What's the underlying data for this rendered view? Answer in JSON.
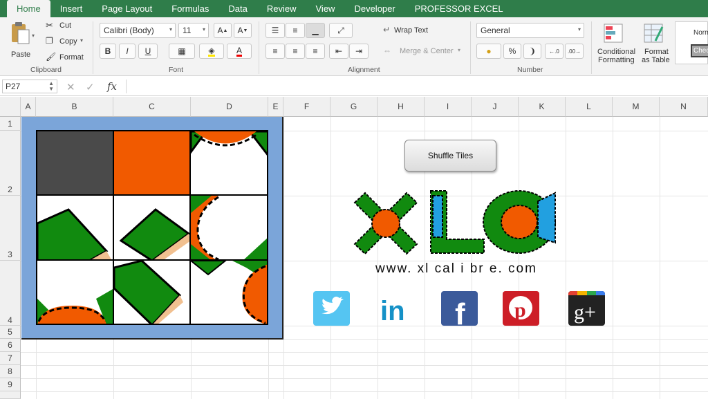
{
  "ribbon": {
    "tabs": [
      "Home",
      "Insert",
      "Page Layout",
      "Formulas",
      "Data",
      "Review",
      "View",
      "Developer",
      "PROFESSOR EXCEL"
    ],
    "clipboard": {
      "paste": "Paste",
      "cut": "Cut",
      "copy": "Copy",
      "format": "Format",
      "label": "Clipboard"
    },
    "font": {
      "name": "Calibri (Body)",
      "size": "11",
      "label": "Font",
      "bold": "B",
      "italic": "I",
      "underline": "U"
    },
    "alignment": {
      "wrap": "Wrap Text",
      "merge": "Merge & Center",
      "label": "Alignment"
    },
    "number": {
      "format": "General",
      "percent": "%",
      "comma": "❩",
      "label": "Number"
    },
    "styles": {
      "conditional": "Conditional",
      "conditional2": "Formatting",
      "format_table": "Format",
      "format_table2": "as Table",
      "normal": "Norm",
      "check": "Chec"
    }
  },
  "formula_bar": {
    "name_box": "P27",
    "fx": "fx",
    "cancel": "✕",
    "confirm": "✓"
  },
  "columns": [
    "A",
    "B",
    "C",
    "D",
    "E",
    "F",
    "G",
    "H",
    "I",
    "J",
    "K",
    "L",
    "M",
    "N"
  ],
  "rows": [
    "1",
    "2",
    "3",
    "4",
    "5",
    "6",
    "7",
    "8",
    "9"
  ],
  "puzzle": {
    "button_label": "Shuffle Tiles"
  },
  "logo": {
    "url": "www. xl cal i br e. com"
  },
  "social": [
    "twitter",
    "linkedin",
    "facebook",
    "pinterest",
    "google-plus"
  ],
  "colors": {
    "excel_green": "#2f7d4a",
    "board": "#7ba5d9",
    "orange": "#f15a00",
    "green": "#118a0f",
    "dark": "#4a4a4a",
    "twitter": "#55c5f2",
    "linkedin": "#1591c7",
    "facebook": "#3b5a9a",
    "pinterest": "#cd1e27"
  }
}
